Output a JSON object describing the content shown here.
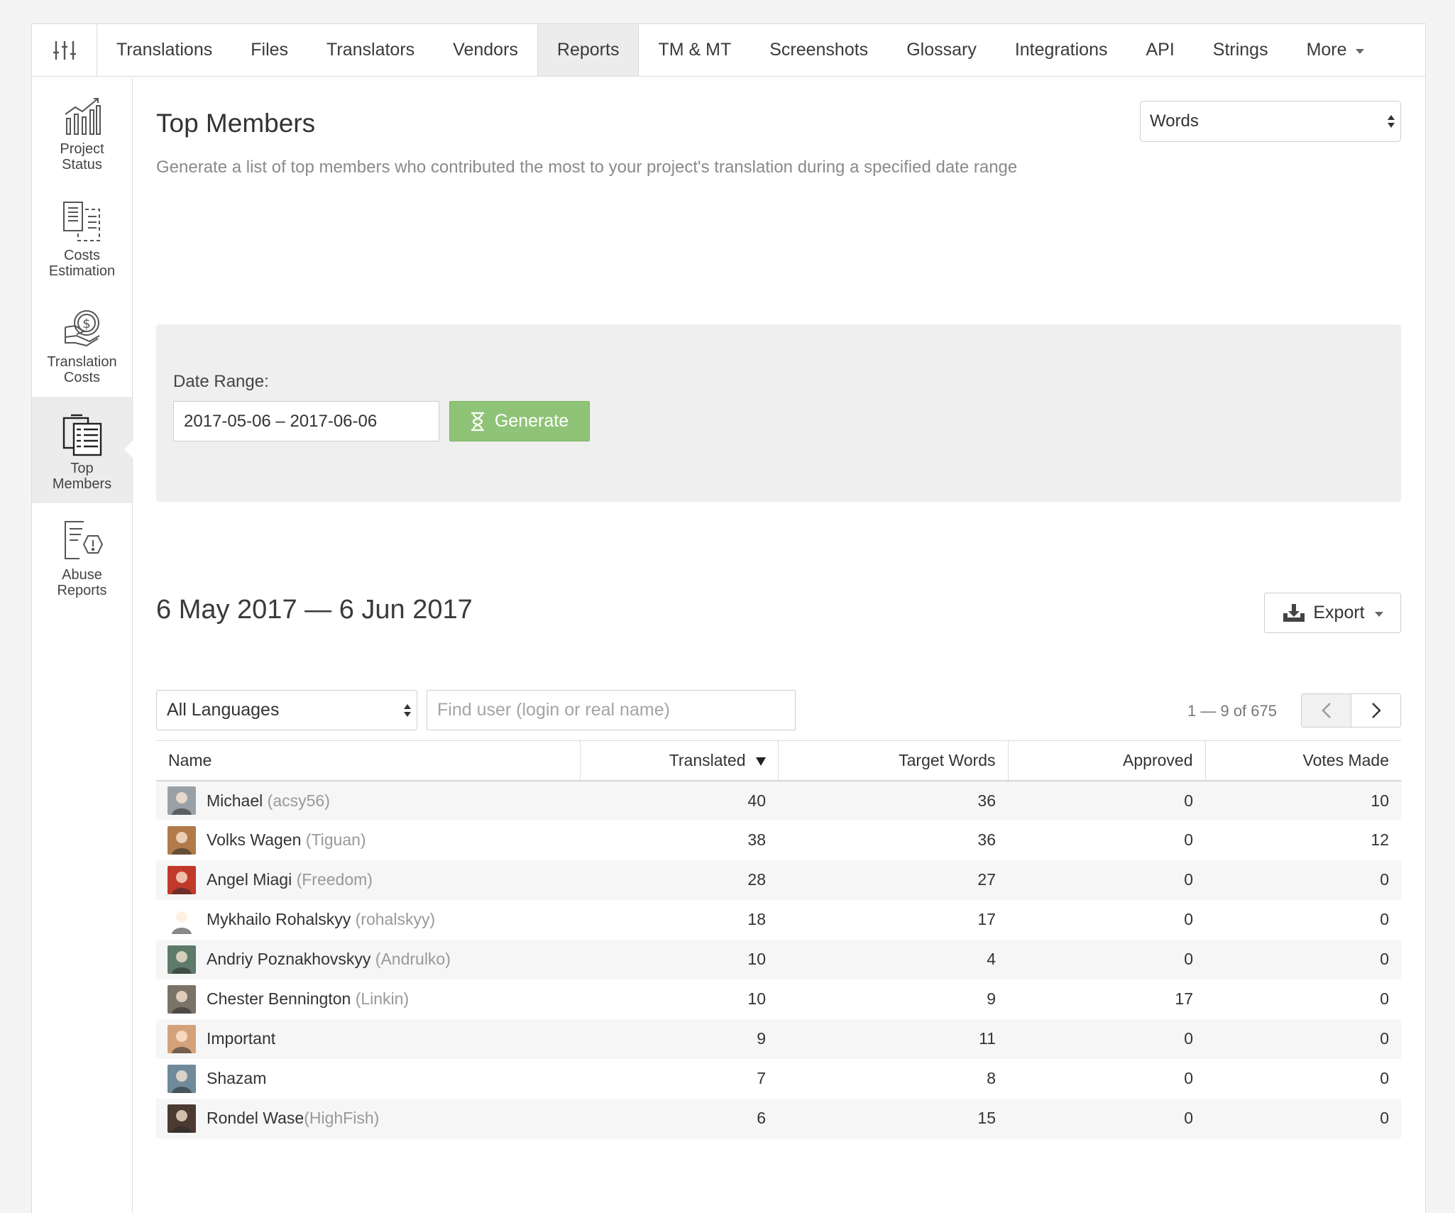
{
  "nav": {
    "tabs": [
      {
        "label": "Translations",
        "key": "translations"
      },
      {
        "label": "Files",
        "key": "files"
      },
      {
        "label": "Translators",
        "key": "translators"
      },
      {
        "label": "Vendors",
        "key": "vendors"
      },
      {
        "label": "Reports",
        "key": "reports",
        "active": true
      },
      {
        "label": "TM & MT",
        "key": "tm-mt"
      },
      {
        "label": "Screenshots",
        "key": "screenshots"
      },
      {
        "label": "Glossary",
        "key": "glossary"
      },
      {
        "label": "Integrations",
        "key": "integrations"
      },
      {
        "label": "API",
        "key": "api"
      },
      {
        "label": "Strings",
        "key": "strings"
      }
    ],
    "more_label": "More"
  },
  "sidebar": {
    "items": [
      {
        "label": "Project\nStatus",
        "icon": "project-status-icon",
        "key": "project-status"
      },
      {
        "label": "Costs\nEstimation",
        "icon": "costs-estimation-icon",
        "key": "costs-estimation"
      },
      {
        "label": "Translation\nCosts",
        "icon": "translation-costs-icon",
        "key": "translation-costs"
      },
      {
        "label": "Top\nMembers",
        "icon": "top-members-icon",
        "key": "top-members",
        "active": true
      },
      {
        "label": "Abuse\nReports",
        "icon": "abuse-reports-icon",
        "key": "abuse-reports"
      }
    ]
  },
  "page": {
    "title": "Top Members",
    "description": "Generate a list of top members who contributed the most to your project's translation during a specified date range",
    "metric_select": "Words"
  },
  "range": {
    "label": "Date Range:",
    "value": "2017-05-06 – 2017-06-06",
    "generate_label": "Generate"
  },
  "results": {
    "heading": "6 May 2017 — 6 Jun 2017",
    "export_label": "Export",
    "language_select": "All Languages",
    "search_placeholder": "Find user (login or real name)",
    "pager_text": "1 — 9 of 675"
  },
  "table": {
    "columns": [
      "Name",
      "Translated",
      "Target Words",
      "Approved",
      "Votes Made"
    ],
    "rows": [
      {
        "name": "Michael",
        "login": "(acsy56)",
        "space": true,
        "translated": "40",
        "target_words": "36",
        "approved": "0",
        "votes": "10",
        "avatar_color": "#9aa1a6"
      },
      {
        "name": "Volks Wagen",
        "login": "(Tiguan)",
        "space": true,
        "translated": "38",
        "target_words": "36",
        "approved": "0",
        "votes": "12",
        "avatar_color": "#b07a4a"
      },
      {
        "name": "Angel Miagi",
        "login": "(Freedom)",
        "space": true,
        "translated": "28",
        "target_words": "27",
        "approved": "0",
        "votes": "0",
        "avatar_color": "#c0392b"
      },
      {
        "name": "Mykhailo Rohalskyy",
        "login": "(rohalskyy)",
        "space": true,
        "translated": "18",
        "target_words": "17",
        "approved": "0",
        "votes": "0",
        "avatar_color": "#ffffff"
      },
      {
        "name": "Andriy Poznakhovskyy",
        "login": "(Andrulko)",
        "space": true,
        "translated": "10",
        "target_words": "4",
        "approved": "0",
        "votes": "0",
        "avatar_color": "#5d7a6a"
      },
      {
        "name": "Chester Bennington",
        "login": "(Linkin)",
        "space": true,
        "translated": "10",
        "target_words": "9",
        "approved": "17",
        "votes": "0",
        "avatar_color": "#7b7268"
      },
      {
        "name": "Important",
        "login": "",
        "space": false,
        "translated": "9",
        "target_words": "11",
        "approved": "0",
        "votes": "0",
        "avatar_color": "#d4a27a"
      },
      {
        "name": "Shazam",
        "login": "",
        "space": false,
        "translated": "7",
        "target_words": "8",
        "approved": "0",
        "votes": "0",
        "avatar_color": "#6f8a9a"
      },
      {
        "name": "Rondel Wase",
        "login": "(HighFish)",
        "space": false,
        "translated": "6",
        "target_words": "15",
        "approved": "0",
        "votes": "0",
        "avatar_color": "#4a3a32"
      }
    ]
  }
}
